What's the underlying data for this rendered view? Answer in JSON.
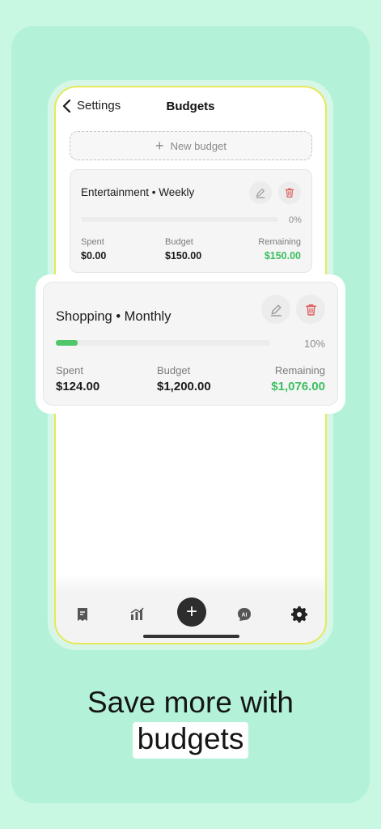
{
  "nav": {
    "back_label": "Settings",
    "title": "Budgets"
  },
  "new_budget": {
    "label": "New budget",
    "icon": "plus-icon"
  },
  "budgets": [
    {
      "title": "Entertainment • Weekly",
      "progress_pct": 0,
      "progress_label": "0%",
      "spent_label": "Spent",
      "spent": "$0.00",
      "budget_label": "Budget",
      "budget": "$150.00",
      "remaining_label": "Remaining",
      "remaining": "$150.00"
    },
    {
      "title": "Shopping • Monthly",
      "progress_pct": 10,
      "progress_label": "10%",
      "spent_label": "Spent",
      "spent": "$124.00",
      "budget_label": "Budget",
      "budget": "$1,200.00",
      "remaining_label": "Remaining",
      "remaining": "$1,076.00"
    }
  ],
  "tabbar": {
    "items": [
      "receipt-icon",
      "chart-icon",
      "add-icon",
      "ai-chat-icon",
      "settings-gear-icon"
    ],
    "add_label": "+"
  },
  "headline": {
    "line1": "Save more with",
    "line2": "budgets"
  },
  "colors": {
    "background": "#c8f7e2",
    "panel": "#b3f2d9",
    "accent_green": "#3cbf60",
    "delete_red": "#e05a5a",
    "phone_border": "#e6e85a"
  }
}
